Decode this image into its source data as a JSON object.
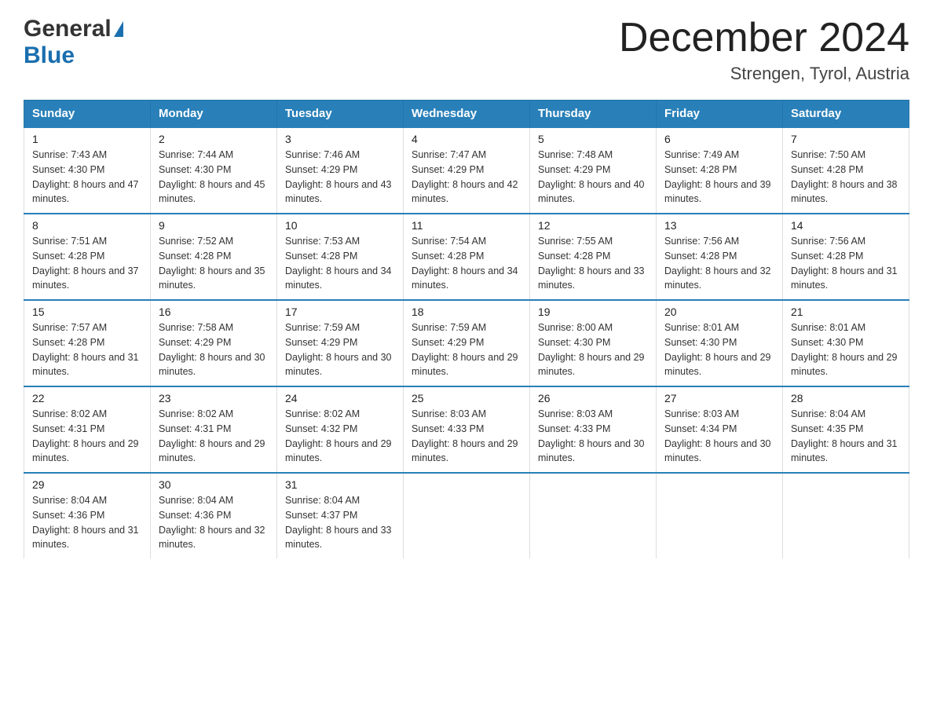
{
  "header": {
    "logo_general": "General",
    "logo_blue": "Blue",
    "month_title": "December 2024",
    "location": "Strengen, Tyrol, Austria"
  },
  "weekdays": [
    "Sunday",
    "Monday",
    "Tuesday",
    "Wednesday",
    "Thursday",
    "Friday",
    "Saturday"
  ],
  "weeks": [
    [
      {
        "day": "1",
        "sunrise": "7:43 AM",
        "sunset": "4:30 PM",
        "daylight": "8 hours and 47 minutes."
      },
      {
        "day": "2",
        "sunrise": "7:44 AM",
        "sunset": "4:30 PM",
        "daylight": "8 hours and 45 minutes."
      },
      {
        "day": "3",
        "sunrise": "7:46 AM",
        "sunset": "4:29 PM",
        "daylight": "8 hours and 43 minutes."
      },
      {
        "day": "4",
        "sunrise": "7:47 AM",
        "sunset": "4:29 PM",
        "daylight": "8 hours and 42 minutes."
      },
      {
        "day": "5",
        "sunrise": "7:48 AM",
        "sunset": "4:29 PM",
        "daylight": "8 hours and 40 minutes."
      },
      {
        "day": "6",
        "sunrise": "7:49 AM",
        "sunset": "4:28 PM",
        "daylight": "8 hours and 39 minutes."
      },
      {
        "day": "7",
        "sunrise": "7:50 AM",
        "sunset": "4:28 PM",
        "daylight": "8 hours and 38 minutes."
      }
    ],
    [
      {
        "day": "8",
        "sunrise": "7:51 AM",
        "sunset": "4:28 PM",
        "daylight": "8 hours and 37 minutes."
      },
      {
        "day": "9",
        "sunrise": "7:52 AM",
        "sunset": "4:28 PM",
        "daylight": "8 hours and 35 minutes."
      },
      {
        "day": "10",
        "sunrise": "7:53 AM",
        "sunset": "4:28 PM",
        "daylight": "8 hours and 34 minutes."
      },
      {
        "day": "11",
        "sunrise": "7:54 AM",
        "sunset": "4:28 PM",
        "daylight": "8 hours and 34 minutes."
      },
      {
        "day": "12",
        "sunrise": "7:55 AM",
        "sunset": "4:28 PM",
        "daylight": "8 hours and 33 minutes."
      },
      {
        "day": "13",
        "sunrise": "7:56 AM",
        "sunset": "4:28 PM",
        "daylight": "8 hours and 32 minutes."
      },
      {
        "day": "14",
        "sunrise": "7:56 AM",
        "sunset": "4:28 PM",
        "daylight": "8 hours and 31 minutes."
      }
    ],
    [
      {
        "day": "15",
        "sunrise": "7:57 AM",
        "sunset": "4:28 PM",
        "daylight": "8 hours and 31 minutes."
      },
      {
        "day": "16",
        "sunrise": "7:58 AM",
        "sunset": "4:29 PM",
        "daylight": "8 hours and 30 minutes."
      },
      {
        "day": "17",
        "sunrise": "7:59 AM",
        "sunset": "4:29 PM",
        "daylight": "8 hours and 30 minutes."
      },
      {
        "day": "18",
        "sunrise": "7:59 AM",
        "sunset": "4:29 PM",
        "daylight": "8 hours and 29 minutes."
      },
      {
        "day": "19",
        "sunrise": "8:00 AM",
        "sunset": "4:30 PM",
        "daylight": "8 hours and 29 minutes."
      },
      {
        "day": "20",
        "sunrise": "8:01 AM",
        "sunset": "4:30 PM",
        "daylight": "8 hours and 29 minutes."
      },
      {
        "day": "21",
        "sunrise": "8:01 AM",
        "sunset": "4:30 PM",
        "daylight": "8 hours and 29 minutes."
      }
    ],
    [
      {
        "day": "22",
        "sunrise": "8:02 AM",
        "sunset": "4:31 PM",
        "daylight": "8 hours and 29 minutes."
      },
      {
        "day": "23",
        "sunrise": "8:02 AM",
        "sunset": "4:31 PM",
        "daylight": "8 hours and 29 minutes."
      },
      {
        "day": "24",
        "sunrise": "8:02 AM",
        "sunset": "4:32 PM",
        "daylight": "8 hours and 29 minutes."
      },
      {
        "day": "25",
        "sunrise": "8:03 AM",
        "sunset": "4:33 PM",
        "daylight": "8 hours and 29 minutes."
      },
      {
        "day": "26",
        "sunrise": "8:03 AM",
        "sunset": "4:33 PM",
        "daylight": "8 hours and 30 minutes."
      },
      {
        "day": "27",
        "sunrise": "8:03 AM",
        "sunset": "4:34 PM",
        "daylight": "8 hours and 30 minutes."
      },
      {
        "day": "28",
        "sunrise": "8:04 AM",
        "sunset": "4:35 PM",
        "daylight": "8 hours and 31 minutes."
      }
    ],
    [
      {
        "day": "29",
        "sunrise": "8:04 AM",
        "sunset": "4:36 PM",
        "daylight": "8 hours and 31 minutes."
      },
      {
        "day": "30",
        "sunrise": "8:04 AM",
        "sunset": "4:36 PM",
        "daylight": "8 hours and 32 minutes."
      },
      {
        "day": "31",
        "sunrise": "8:04 AM",
        "sunset": "4:37 PM",
        "daylight": "8 hours and 33 minutes."
      },
      null,
      null,
      null,
      null
    ]
  ]
}
